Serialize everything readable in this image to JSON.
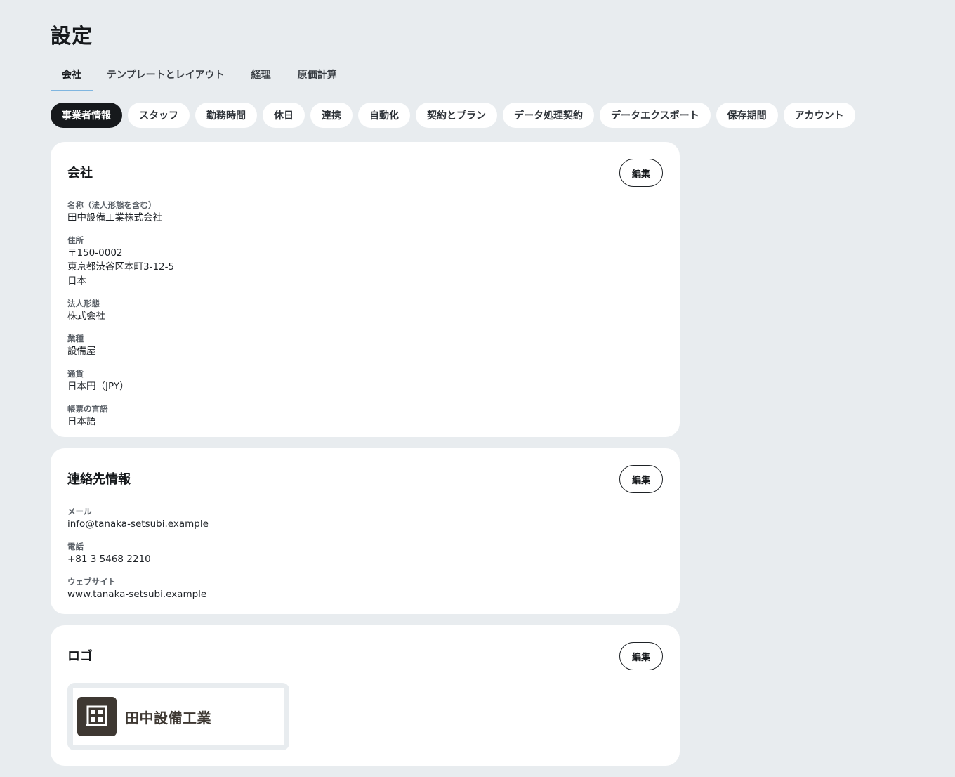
{
  "page": {
    "title": "設定"
  },
  "tabs": [
    {
      "label": "会社",
      "active": true
    },
    {
      "label": "テンプレートとレイアウト",
      "active": false
    },
    {
      "label": "経理",
      "active": false
    },
    {
      "label": "原価計算",
      "active": false
    }
  ],
  "subtabs": [
    {
      "label": "事業者情報",
      "active": true
    },
    {
      "label": "スタッフ",
      "active": false
    },
    {
      "label": "勤務時間",
      "active": false
    },
    {
      "label": "休日",
      "active": false
    },
    {
      "label": "連携",
      "active": false
    },
    {
      "label": "自動化",
      "active": false
    },
    {
      "label": "契約とプラン",
      "active": false
    },
    {
      "label": "データ処理契約",
      "active": false
    },
    {
      "label": "データエクスポート",
      "active": false
    },
    {
      "label": "保存期間",
      "active": false
    },
    {
      "label": "アカウント",
      "active": false
    }
  ],
  "company": {
    "title": "会社",
    "edit_label": "編集",
    "fields": {
      "name_label": "名称（法人形態を含む）",
      "name_value": "田中設備工業株式会社",
      "address_label": "住所",
      "address_postal": "〒150-0002",
      "address_line": "東京都渋谷区本町3-12-5",
      "address_country": "日本",
      "legal_form_label": "法人形態",
      "legal_form_value": "株式会社",
      "industry_label": "業種",
      "industry_value": "設備屋",
      "currency_label": "通貨",
      "currency_value": "日本円（JPY）",
      "doc_lang_label": "帳票の言語",
      "doc_lang_value": "日本語"
    }
  },
  "contact": {
    "title": "連絡先情報",
    "edit_label": "編集",
    "fields": {
      "email_label": "メール",
      "email_value": "info@tanaka-setsubi.example",
      "phone_label": "電話",
      "phone_value": "+81 3 5468 2210",
      "website_label": "ウェブサイト",
      "website_value": "www.tanaka-setsubi.example"
    }
  },
  "logo": {
    "title": "ロゴ",
    "edit_label": "編集",
    "brand_text": "田中設備工業",
    "brand_icon": "building-icon",
    "brand_color": "#3e3832"
  }
}
